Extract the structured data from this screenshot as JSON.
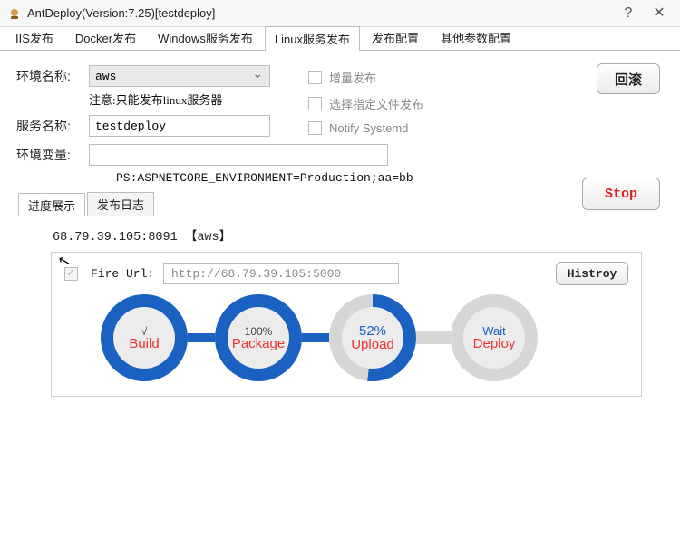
{
  "window": {
    "title": "AntDeploy(Version:7.25)[testdeploy]",
    "help": "?",
    "close": "✕"
  },
  "tabs": {
    "iis": "IIS发布",
    "docker": "Docker发布",
    "winsvc": "Windows服务发布",
    "linux": "Linux服务发布",
    "pubcfg": "发布配置",
    "othercfg": "其他参数配置"
  },
  "form": {
    "env_label": "环境名称:",
    "env_value": "aws",
    "env_note": "注意:只能发布linux服务器",
    "svc_label": "服务名称:",
    "svc_value": "testdeploy",
    "var_label": "环境变量:",
    "var_value": "",
    "ps_line": "PS:ASPNETCORE_ENVIRONMENT=Production;aa=bb"
  },
  "options": {
    "incremental": "增量发布",
    "select_files": "选择指定文件发布",
    "notify_systemd": "Notify Systemd"
  },
  "buttons": {
    "rollback": "回滚",
    "stop": "Stop",
    "history": "Histroy"
  },
  "subtabs": {
    "progress": "进度展示",
    "log": "发布日志"
  },
  "deploy": {
    "host_line": "68.79.39.105:8091 【aws】",
    "fire_label": "Fire Url:",
    "fire_url": "http://68.79.39.105:5000"
  },
  "pipeline": {
    "build": {
      "pct": "√",
      "name": "Build"
    },
    "package": {
      "pct": "100%",
      "name": "Package"
    },
    "upload": {
      "pct": "52%",
      "name": "Upload",
      "deg": "187deg"
    },
    "deploy": {
      "pct": "Wait",
      "name": "Deploy"
    }
  }
}
